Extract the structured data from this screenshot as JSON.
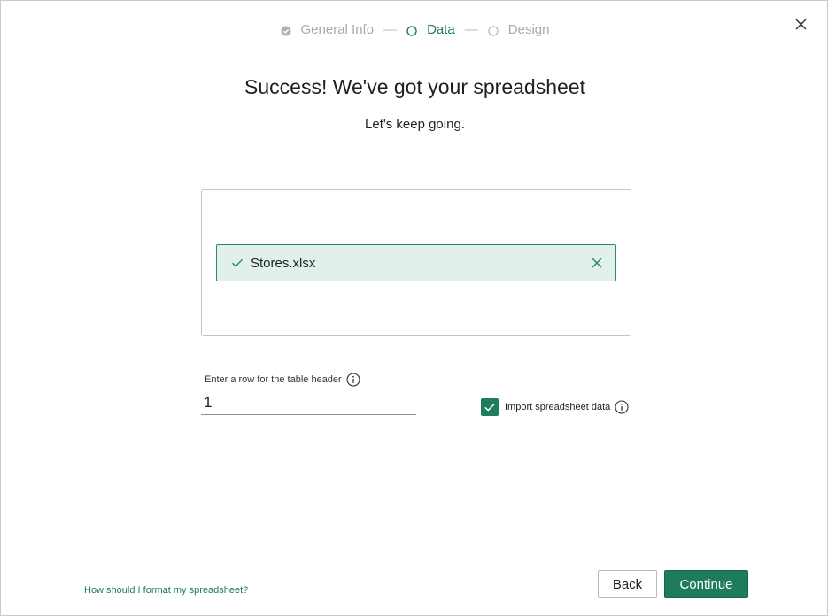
{
  "stepper": {
    "steps": [
      {
        "label": "General Info",
        "state": "done"
      },
      {
        "label": "Data",
        "state": "current"
      },
      {
        "label": "Design",
        "state": "todo"
      }
    ],
    "separator": "—"
  },
  "dialog": {
    "title": "Success! We've got your spreadsheet",
    "subtitle": "Let's keep going."
  },
  "upload": {
    "file_name": "Stores.xlsx"
  },
  "header_row": {
    "label": "Enter a row for the table header",
    "value": "1"
  },
  "import": {
    "label": "Import spreadsheet data",
    "checked": true
  },
  "footer": {
    "help_link": "How should I format my spreadsheet?",
    "back_label": "Back",
    "continue_label": "Continue"
  },
  "colors": {
    "accent": "#1e7b5c",
    "chip_bg": "#e2f0eb",
    "muted": "#a9a9a9"
  },
  "icons": {
    "close": "close-icon",
    "done_step": "check-circle-icon",
    "current_step": "circle-outline-icon",
    "todo_step": "circle-outline-icon",
    "file_check": "check-icon",
    "file_remove": "x-icon",
    "info": "info-icon",
    "checkbox": "check-icon"
  }
}
